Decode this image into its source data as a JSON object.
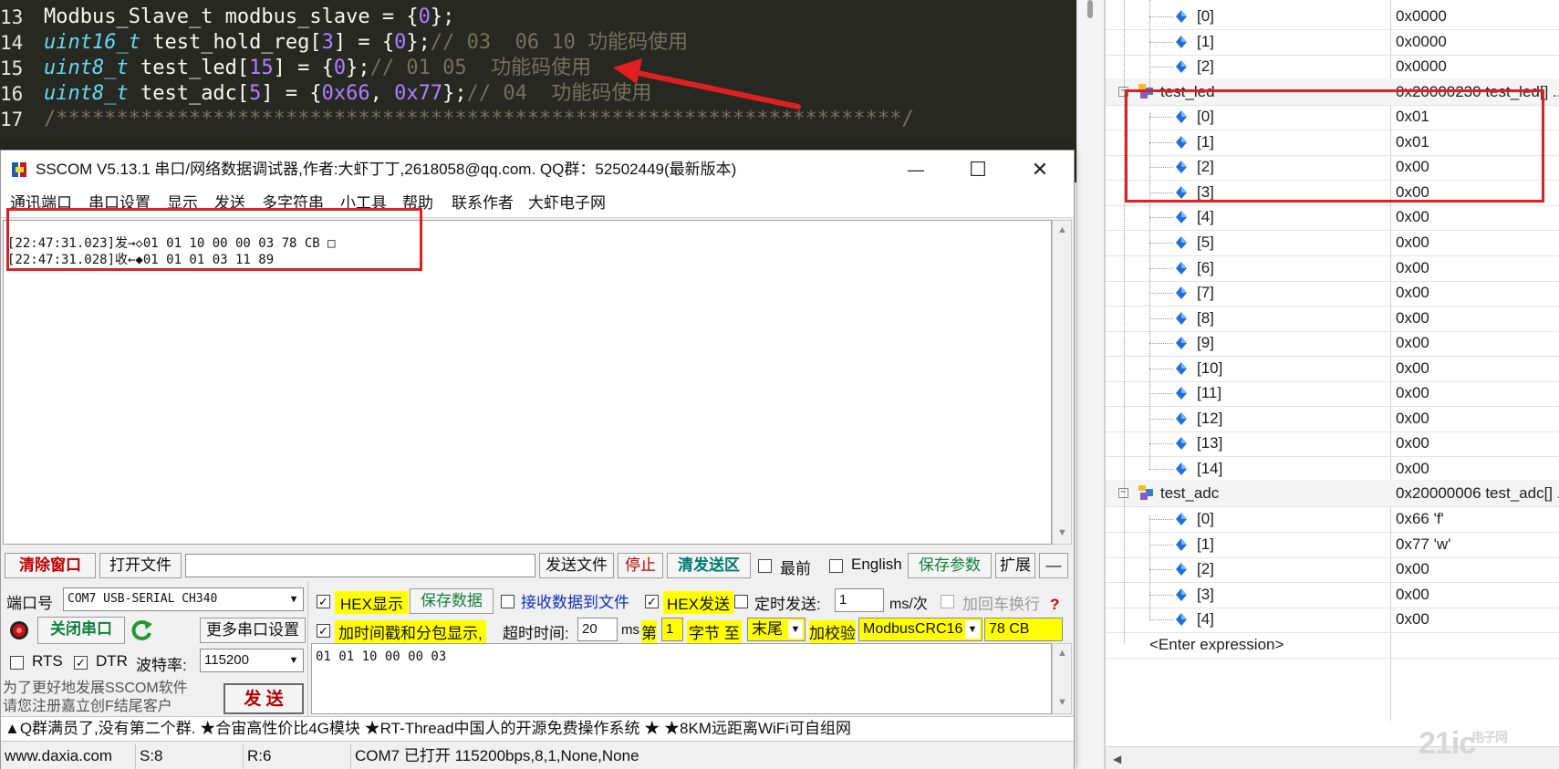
{
  "editor": {
    "lines": [
      {
        "no": "13",
        "parts": [
          {
            "t": "Modbus_Slave_t modbus_slave = {",
            "c": "plain"
          },
          {
            "t": "0",
            "c": "num"
          },
          {
            "t": "};",
            "c": "plain"
          }
        ]
      },
      {
        "no": "14",
        "parts": [
          {
            "t": "uint16_t",
            "c": "type"
          },
          {
            "t": " test_hold_reg[",
            "c": "plain"
          },
          {
            "t": "3",
            "c": "num"
          },
          {
            "t": "] = {",
            "c": "plain"
          },
          {
            "t": "0",
            "c": "num"
          },
          {
            "t": "};",
            "c": "plain"
          },
          {
            "t": "// 03  06 10 功能码使用",
            "c": "cmt"
          }
        ]
      },
      {
        "no": "15",
        "parts": [
          {
            "t": "uint8_t",
            "c": "type"
          },
          {
            "t": " test_led[",
            "c": "plain"
          },
          {
            "t": "15",
            "c": "num"
          },
          {
            "t": "] = {",
            "c": "plain"
          },
          {
            "t": "0",
            "c": "num"
          },
          {
            "t": "};",
            "c": "plain"
          },
          {
            "t": "// 01 05  功能码使用",
            "c": "cmt"
          }
        ]
      },
      {
        "no": "16",
        "parts": [
          {
            "t": "uint8_t",
            "c": "type"
          },
          {
            "t": " test_adc[",
            "c": "plain"
          },
          {
            "t": "5",
            "c": "num"
          },
          {
            "t": "] = {",
            "c": "plain"
          },
          {
            "t": "0x66",
            "c": "num"
          },
          {
            "t": ", ",
            "c": "plain"
          },
          {
            "t": "0x77",
            "c": "num"
          },
          {
            "t": "};",
            "c": "plain"
          },
          {
            "t": "// 04  功能码使用",
            "c": "cmt"
          }
        ]
      },
      {
        "no": "17",
        "parts": [
          {
            "t": "/**********************************************************************/",
            "c": "cmt"
          }
        ]
      }
    ]
  },
  "watch": {
    "rows": [
      {
        "kind": "item",
        "name": "[0]",
        "value": "0x0000"
      },
      {
        "kind": "item",
        "name": "[1]",
        "value": "0x0000"
      },
      {
        "kind": "item",
        "name": "[2]",
        "value": "0x0000"
      },
      {
        "kind": "group",
        "name": "test_led",
        "value": "0x20000230 test_led[] ..."
      },
      {
        "kind": "item",
        "name": "[0]",
        "value": "0x01"
      },
      {
        "kind": "item",
        "name": "[1]",
        "value": "0x01"
      },
      {
        "kind": "item",
        "name": "[2]",
        "value": "0x00"
      },
      {
        "kind": "item",
        "name": "[3]",
        "value": "0x00"
      },
      {
        "kind": "item",
        "name": "[4]",
        "value": "0x00"
      },
      {
        "kind": "item",
        "name": "[5]",
        "value": "0x00"
      },
      {
        "kind": "item",
        "name": "[6]",
        "value": "0x00"
      },
      {
        "kind": "item",
        "name": "[7]",
        "value": "0x00"
      },
      {
        "kind": "item",
        "name": "[8]",
        "value": "0x00"
      },
      {
        "kind": "item",
        "name": "[9]",
        "value": "0x00"
      },
      {
        "kind": "item",
        "name": "[10]",
        "value": "0x00"
      },
      {
        "kind": "item",
        "name": "[11]",
        "value": "0x00"
      },
      {
        "kind": "item",
        "name": "[12]",
        "value": "0x00"
      },
      {
        "kind": "item",
        "name": "[13]",
        "value": "0x00"
      },
      {
        "kind": "item",
        "name": "[14]",
        "value": "0x00"
      },
      {
        "kind": "group",
        "name": "test_adc",
        "value": "0x20000006 test_adc[] ..."
      },
      {
        "kind": "item",
        "name": "[0]",
        "value": "0x66 'f'"
      },
      {
        "kind": "item",
        "name": "[1]",
        "value": "0x77 'w'"
      },
      {
        "kind": "item",
        "name": "[2]",
        "value": "0x00"
      },
      {
        "kind": "item",
        "name": "[3]",
        "value": "0x00"
      },
      {
        "kind": "item",
        "name": "[4]",
        "value": "0x00"
      },
      {
        "kind": "expr",
        "name": "<Enter expression>",
        "value": ""
      }
    ],
    "watermark": "21ic",
    "watermark_sub": "电子网"
  },
  "sscom": {
    "title": "SSCOM V5.13.1 串口/网络数据调试器,作者:大虾丁丁,2618058@qq.com. QQ群：52502449(最新版本)",
    "window_buttons": {
      "minimize": "—",
      "maximize": "☐",
      "close": "✕"
    },
    "menu": [
      "通讯端口",
      "串口设置",
      "显示",
      "发送",
      "多字符串",
      "小工具",
      "帮助",
      "联系作者",
      "大虾电子网"
    ],
    "log": [
      "[22:47:31.023]发→◇01 01 10 00 00 03 78 CB □",
      "[22:47:31.028]收←◆01 01 01 03 11 89"
    ],
    "toolbar": {
      "clear": "清除窗口",
      "open_file": "打开文件",
      "file_path": "",
      "send_file": "发送文件",
      "stop": "停止",
      "clear_send": "清发送区",
      "topmost": "最前",
      "english": "English",
      "save_params": "保存参数",
      "expand": "扩展",
      "collapse": "—"
    },
    "port": {
      "port_label": "端口号",
      "port_value": "COM7 USB-SERIAL CH340",
      "close_port": "关闭串口",
      "more_settings": "更多串口设置",
      "rts": "RTS",
      "dtr": "DTR",
      "baud_label": "波特率:",
      "baud_value": "115200",
      "promo": "为了更好地发展SSCOM软件\n请您注册嘉立创F结尾客户",
      "send_btn": "发 送"
    },
    "options": {
      "hex_show": "HEX显示",
      "save_data": "保存数据",
      "recv_to_file": "接收数据到文件",
      "hex_send": "HEX发送",
      "timed_send": "定时发送:",
      "interval": "1",
      "interval_unit": "ms/次",
      "add_crlf": "加回车换行",
      "help_mark": "?",
      "timestamp": "加时间戳和分包显示,",
      "timeout_label": "超时时间:",
      "timeout_value": "20",
      "timeout_unit": "ms",
      "byte_label_pre": "第",
      "byte_start": "1",
      "byte_label_mid": "字节 至",
      "byte_end": "末尾",
      "checksum_label": "加校验",
      "checksum_value": "ModbusCRC16",
      "checksum_result": "78 CB"
    },
    "send_text": "01 01 10 00 00 03",
    "ticker": "▲Q群满员了,没有第二个群. ★合宙高性价比4G模块 ★RT-Thread中国人的开源免费操作系统 ★ ★8KM远距离WiFi可自组网",
    "status": {
      "site": "www.daxia.com",
      "sent": "S:8",
      "recv": "R:6",
      "port_state": "COM7 已打开  115200bps,8,1,None,None"
    }
  },
  "colors": {
    "editor_bg": "#272822",
    "annotation_red": "#e02020",
    "highlight_yellow": "#ffff00"
  }
}
